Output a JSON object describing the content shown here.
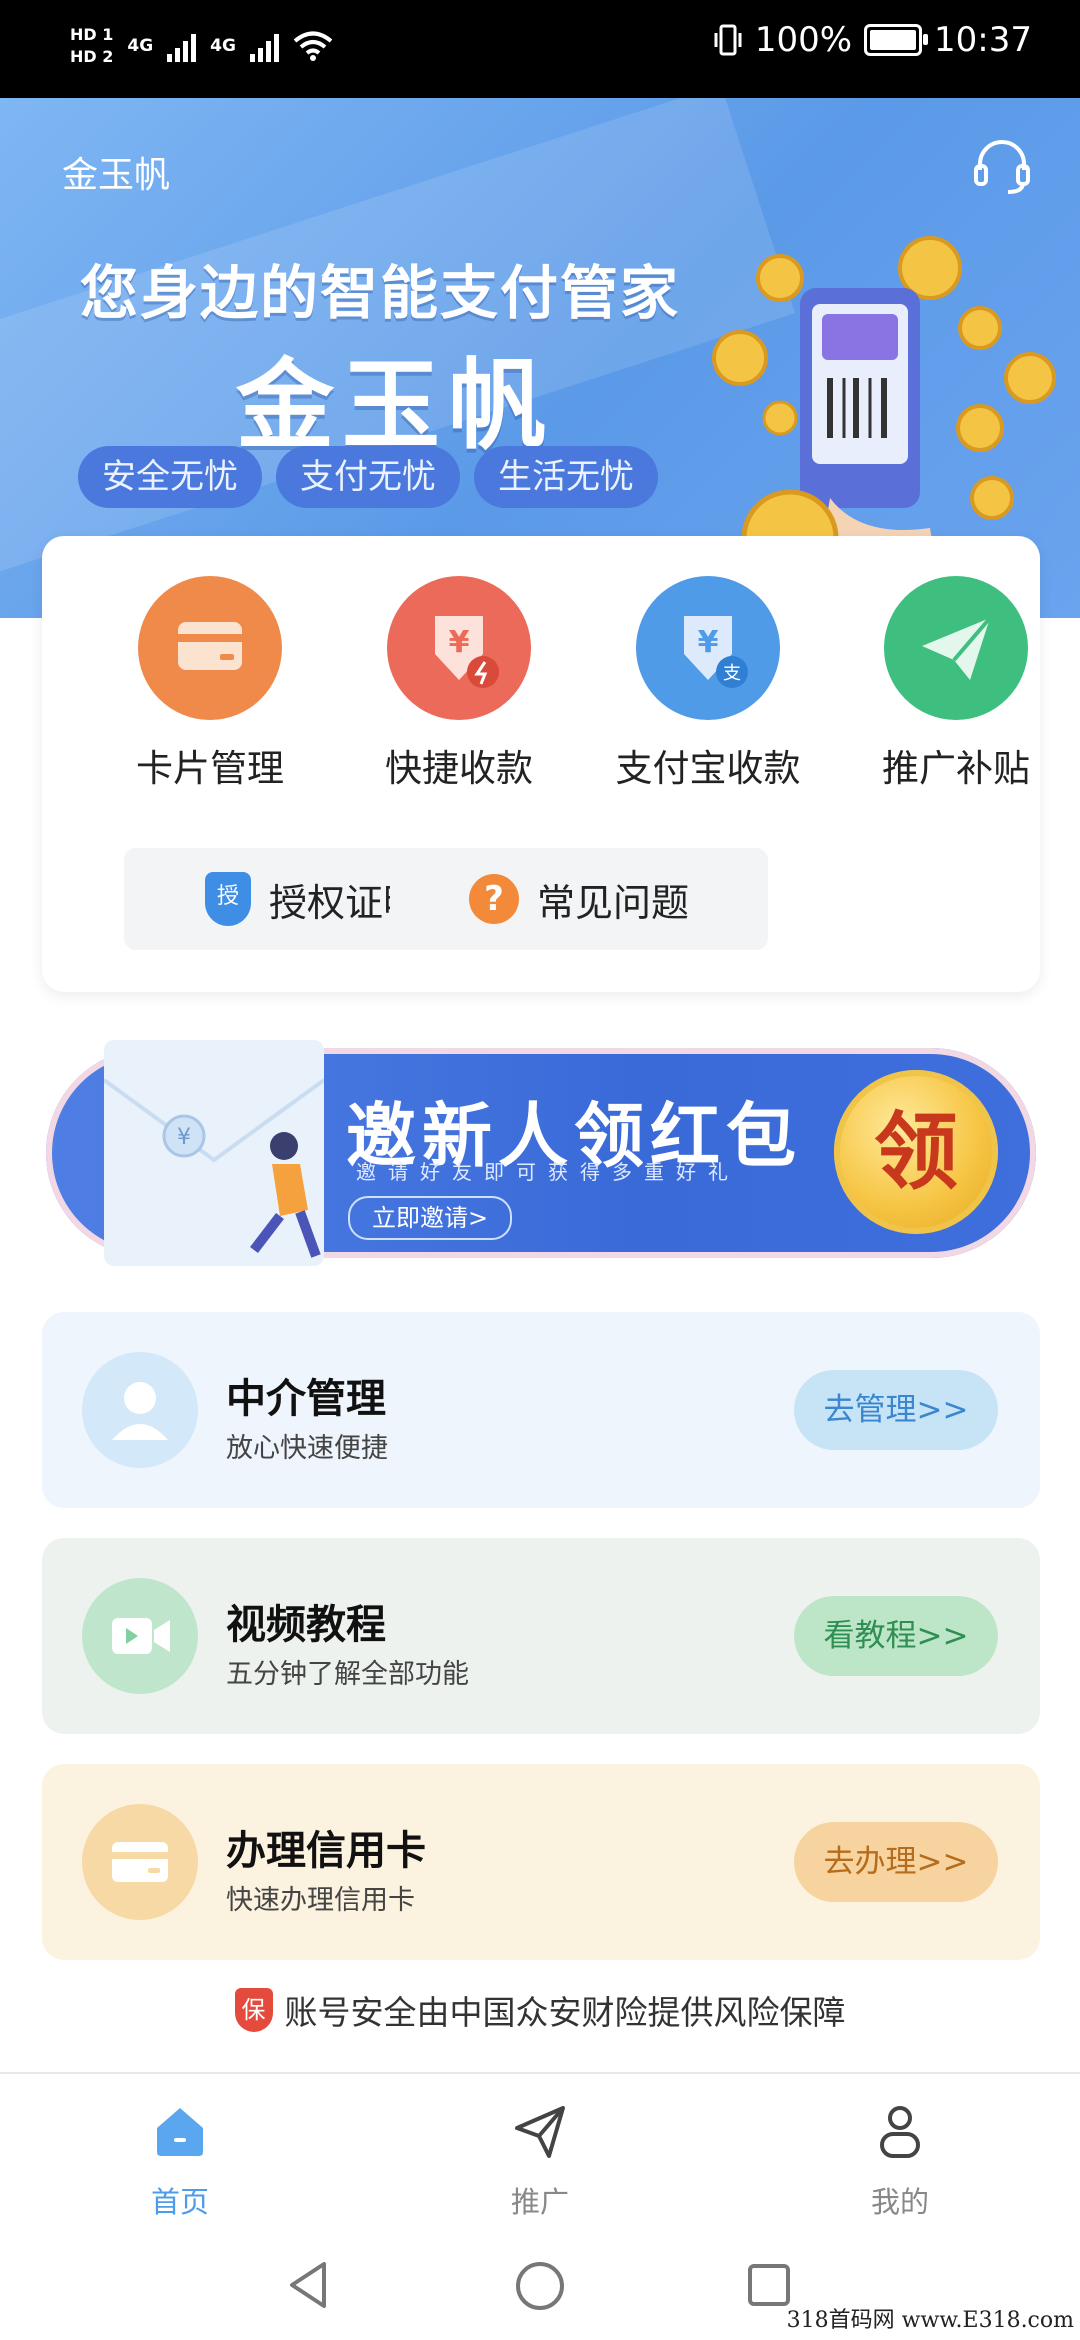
{
  "status_bar": {
    "hd1": "HD 1",
    "hd2": "HD 2",
    "net1": "4G",
    "net2": "4G",
    "battery": "100%",
    "time": "10:37"
  },
  "header": {
    "app_name": "金玉帆",
    "slogan": "您身边的智能支付管家",
    "brand": "金玉帆",
    "tags": [
      "安全无忧",
      "支付无忧",
      "生活无忧"
    ]
  },
  "quick_actions": [
    {
      "label": "卡片管理",
      "icon": "card-icon",
      "color": "#f08a4b"
    },
    {
      "label": "快捷收款",
      "icon": "yuan-flash-icon",
      "color": "#ec6a5a"
    },
    {
      "label": "支付宝收款",
      "icon": "yuan-alipay-icon",
      "color": "#4f9be8"
    },
    {
      "label": "推广补贴",
      "icon": "paper-plane-icon",
      "color": "#3fbf7f"
    }
  ],
  "quick_buttons": [
    {
      "label": "授权证明",
      "icon": "shield-auth-icon",
      "icon_text": "授"
    },
    {
      "label": "常见问题",
      "icon": "question-icon",
      "icon_text": "?"
    }
  ],
  "invite": {
    "title": "邀新人领红包",
    "subtitle": "邀请好友即可获得多重好礼",
    "button": "立即邀请>",
    "coin": "领"
  },
  "features": [
    {
      "title": "中介管理",
      "subtitle": "放心快速便捷",
      "button": "去管理>>",
      "bg": "#eef5fd",
      "icon_bg": "#d3e8f8",
      "btn_bg": "#c7e4f7",
      "btn_color": "#3a86cf",
      "icon": "agent-person-icon"
    },
    {
      "title": "视频教程",
      "subtitle": "五分钟了解全部功能",
      "button": "看教程>>",
      "bg": "#eef2ef",
      "icon_bg": "#bfe6cd",
      "btn_bg": "#bde6c8",
      "btn_color": "#2f8f52",
      "icon": "video-camera-icon"
    },
    {
      "title": "办理信用卡",
      "subtitle": "快速办理信用卡",
      "button": "去办理>>",
      "bg": "#fcf2e0",
      "icon_bg": "#f7d9a6",
      "btn_bg": "#f7d49f",
      "btn_color": "#b56d1d",
      "icon": "credit-card-icon"
    }
  ],
  "insurance": {
    "badge": "保",
    "text": "账号安全由中国众安财险提供风险保障"
  },
  "tabs": [
    {
      "label": "首页",
      "icon": "home-icon",
      "active": true
    },
    {
      "label": "推广",
      "icon": "send-icon",
      "active": false
    },
    {
      "label": "我的",
      "icon": "profile-icon",
      "active": false
    }
  ],
  "watermark": "318首码网 www.E318.com"
}
